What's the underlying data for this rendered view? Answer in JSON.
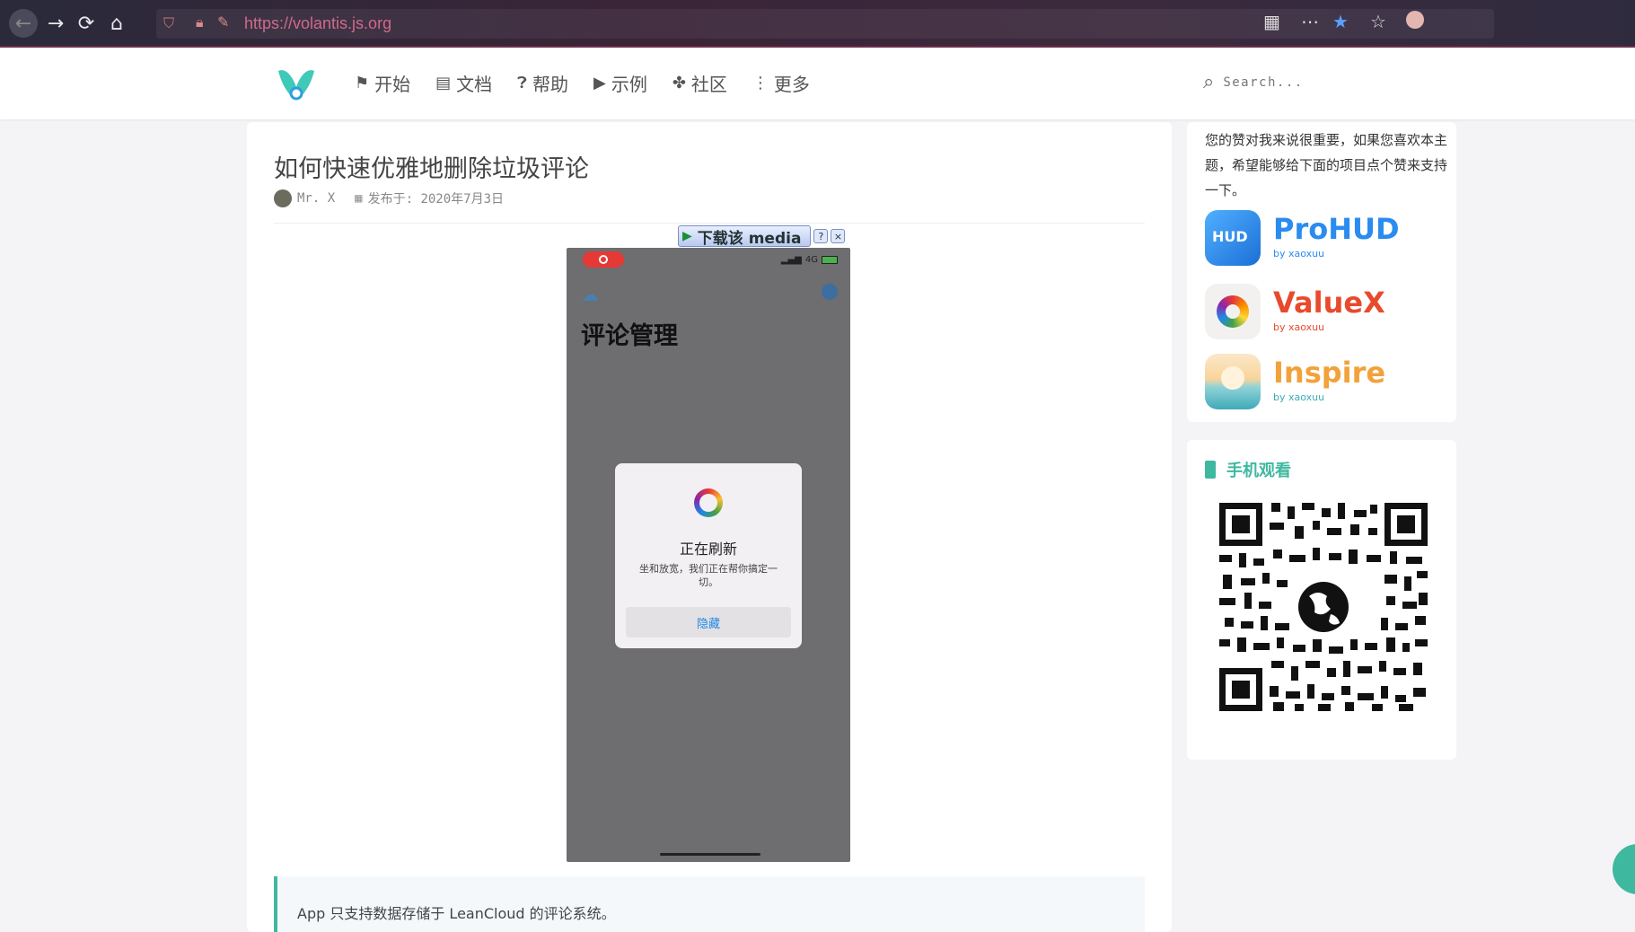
{
  "browser": {
    "url": "https://volantis.js.org"
  },
  "nav": {
    "items": [
      {
        "label": "开始",
        "icon": "flag-icon"
      },
      {
        "label": "文档",
        "icon": "book-icon"
      },
      {
        "label": "帮助",
        "icon": "question-icon"
      },
      {
        "label": "示例",
        "icon": "play-circle-icon"
      },
      {
        "label": "社区",
        "icon": "fan-icon"
      },
      {
        "label": "更多",
        "icon": "ellipsis-vertical-icon"
      }
    ],
    "search_placeholder": "Search..."
  },
  "article": {
    "title": "如何快速优雅地删除垃圾评论",
    "author": "Mr. X",
    "date": "发布于: 2020年7月3日",
    "media_bar": {
      "download_label": "下载该 media"
    },
    "phone": {
      "network": "4G",
      "title": "评论管理",
      "dialog_title": "正在刷新",
      "dialog_message": "坐和放宽，我们正在帮你搞定一切。",
      "dialog_button": "隐藏"
    },
    "note": "App 只支持数据存储于 LeanCloud 的评论系统。"
  },
  "sidebar": {
    "intro": "您的赞对我来说很重要，如果您喜欢本主题，希望能够给下面的项目点个赞来支持一下。",
    "apps": [
      {
        "name": "ProHUD",
        "by": "by xaoxuu",
        "color": "#2b8cf0"
      },
      {
        "name": "ValueX",
        "by": "by xaoxuu",
        "color": "#e84a2c"
      },
      {
        "name": "Inspire",
        "by": "by xaoxuu",
        "color": "#f2a23a"
      }
    ],
    "qr_title": "手机观看",
    "accent": "#3fb8a0"
  }
}
